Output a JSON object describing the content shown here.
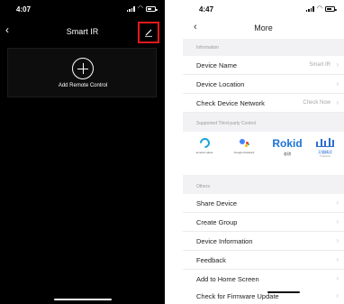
{
  "left": {
    "status": {
      "time": "4:07",
      "battery_level_percent": 60
    },
    "header": {
      "back_glyph": "‹",
      "title": "Smart IR",
      "edit_icon": "edit-pencil-icon",
      "highlight_color": "#e0191c"
    },
    "add_card": {
      "label": "Add Remote Control",
      "icon": "plus-circle-icon"
    }
  },
  "right": {
    "status": {
      "time": "4:47",
      "battery_level_percent": 70
    },
    "header": {
      "back_glyph": "‹",
      "title": "More"
    },
    "sections": {
      "information": "Information",
      "third_party": "Supported Third-party Control",
      "others": "Others"
    },
    "info_rows": [
      {
        "label": "Device Name",
        "value": "Smart IR",
        "chevron": "›"
      },
      {
        "label": "Device Location",
        "value": "",
        "chevron": "›"
      },
      {
        "label": "Check Device Network",
        "value": "Check Now",
        "chevron": "›"
      }
    ],
    "third_party": {
      "alexa": {
        "caption": "amazon alexa"
      },
      "google": {
        "caption": "Google Assistant"
      },
      "rokid": {
        "word": "Rokid",
        "sub": "若琪"
      },
      "tmall": {
        "sub": "天猫精灵",
        "sub2": "TmallGenie"
      },
      "pager_active_index": 0,
      "pager_count": 2
    },
    "other_rows": [
      {
        "label": "Share Device",
        "chevron": "›"
      },
      {
        "label": "Create Group",
        "chevron": "›"
      },
      {
        "label": "Device Information",
        "chevron": "›"
      },
      {
        "label": "Feedback",
        "chevron": "›"
      },
      {
        "label": "Add to Home Screen",
        "chevron": "›"
      },
      {
        "label": "Check for Firmware Update",
        "chevron": "›"
      }
    ]
  }
}
